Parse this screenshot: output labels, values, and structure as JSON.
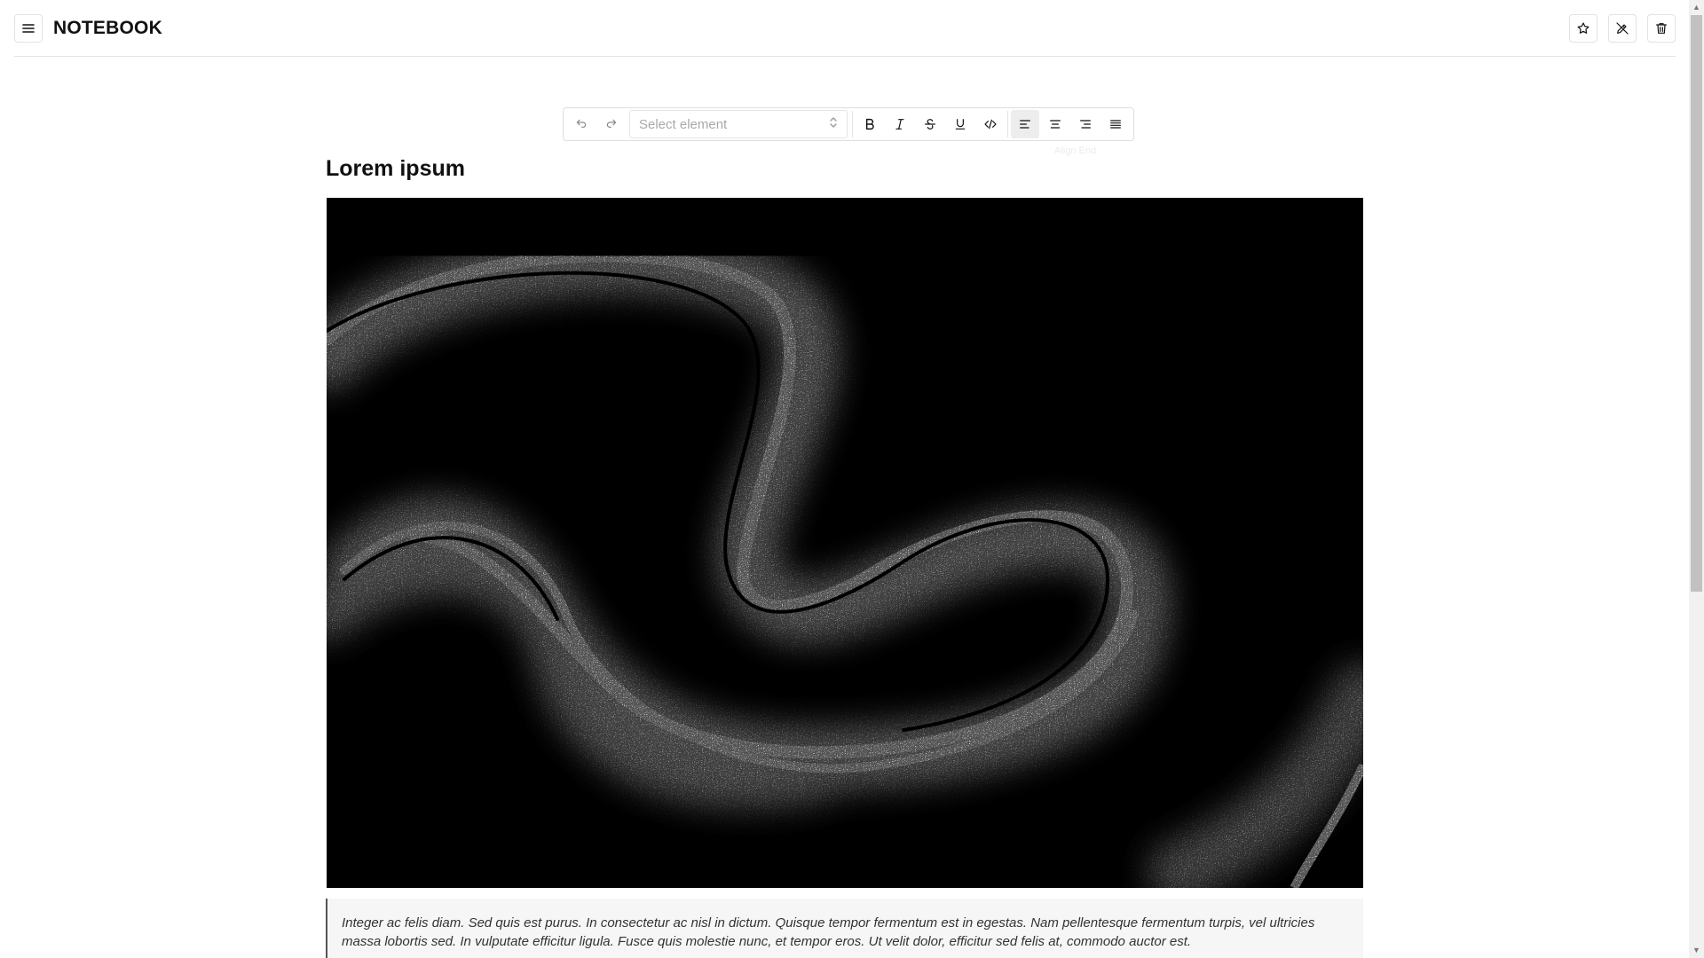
{
  "app": {
    "title": "NOTEBOOK",
    "menu_icon": "hamburger-menu-icon",
    "actions": [
      {
        "name": "favorite-button",
        "icon": "star-icon"
      },
      {
        "name": "edit-disabled-button",
        "icon": "pencil-off-icon"
      },
      {
        "name": "delete-button",
        "icon": "trash-icon"
      }
    ]
  },
  "toolbar": {
    "undo_icon": "undo-icon",
    "redo_icon": "redo-icon",
    "select_placeholder": "Select element",
    "format_icons": [
      "bold-icon",
      "italic-icon",
      "strikethrough-icon",
      "underline-icon",
      "code-icon"
    ],
    "align_icons": [
      "align-start-icon",
      "align-center-icon",
      "align-end-icon",
      "align-justify-icon"
    ],
    "active_align": "align-start",
    "tooltip": "Align End"
  },
  "document": {
    "title": "Lorem ipsum",
    "quote": "Integer ac felis diam. Sed quis est purus. In consectetur ac nisl in dictum. Quisque tempor fermentum est in egestas. Nam pellentesque fermentum turpis, vel ultricies massa lobortis sed. In vulputate efficitur ligula. Fusce quis molestie nunc, et tempor eros. Ut velit dolor, efficitur sed felis at, commodo auctor est."
  },
  "colors": {
    "border": "#e4e4e4",
    "active_button": "#ededed",
    "quote_bg": "#f6f6f6",
    "quote_border": "#555555"
  }
}
